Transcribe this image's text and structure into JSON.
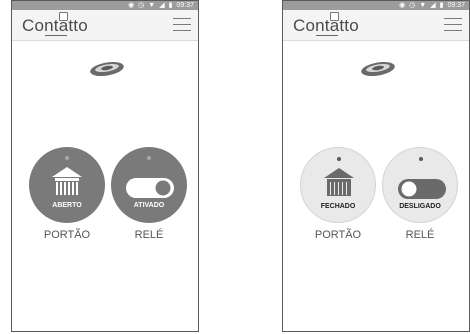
{
  "screens": [
    {
      "status": {
        "time": "09:37",
        "icons": [
          "vibrate-icon",
          "alarm-icon",
          "wifi-icon",
          "signal-icon",
          "battery-icon"
        ]
      },
      "app": {
        "logo": "Contatto",
        "menu_icon": "hamburger-menu-icon"
      },
      "controls": [
        {
          "state_label": "ABERTO",
          "caption": "PORTÃO",
          "icon": "gate-open-icon"
        },
        {
          "state_label": "ATIVADO",
          "caption": "RELÉ",
          "icon": "toggle-on-icon"
        }
      ]
    },
    {
      "status": {
        "time": "09:37",
        "icons": [
          "vibrate-icon",
          "alarm-icon",
          "wifi-icon",
          "signal-icon",
          "battery-icon"
        ]
      },
      "app": {
        "logo": "Contatto",
        "menu_icon": "hamburger-menu-icon"
      },
      "controls": [
        {
          "state_label": "FECHADO",
          "caption": "PORTÃO",
          "icon": "gate-closed-icon"
        },
        {
          "state_label": "DESLIGADO",
          "caption": "RELÉ",
          "icon": "toggle-off-icon"
        }
      ]
    }
  ],
  "colors": {
    "active_circle": "#7a7a7a",
    "inactive_circle": "#e9e9e9",
    "statusbar": "#9c9c9c"
  }
}
